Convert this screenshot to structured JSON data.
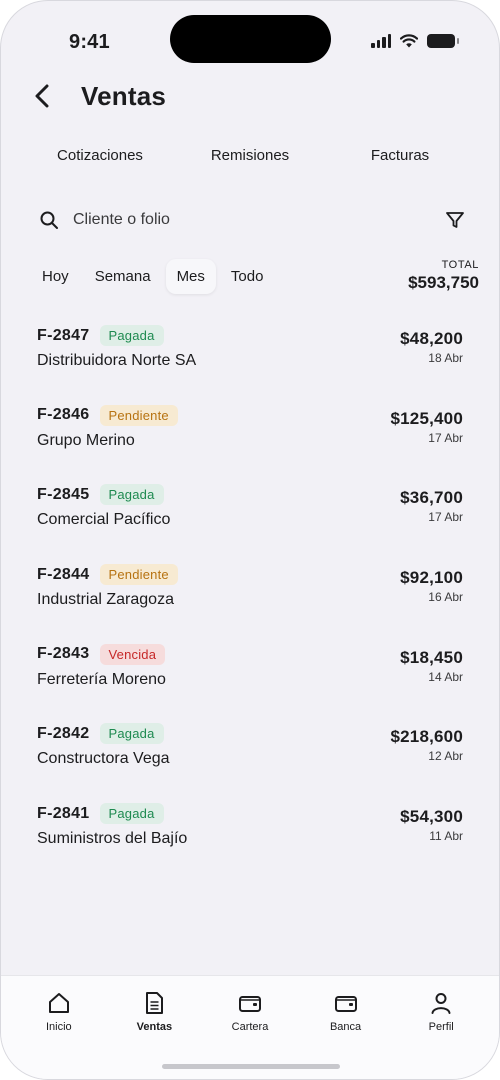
{
  "status": {
    "time": "9:41"
  },
  "header": {
    "title": "Ventas"
  },
  "segments": [
    "Cotizaciones",
    "Remisiones",
    "Facturas"
  ],
  "search": {
    "placeholder": "Cliente o folio"
  },
  "periods": [
    "Hoy",
    "Semana",
    "Mes",
    "Todo"
  ],
  "active_period": "Mes",
  "total": {
    "label": "TOTAL",
    "value": "$593,750"
  },
  "invoices": [
    {
      "folio": "F-2847",
      "status": "Pagada",
      "status_key": "pagada",
      "client": "Distribuidora Norte SA",
      "amount": "$48,200",
      "date": "18 Abr"
    },
    {
      "folio": "F-2846",
      "status": "Pendiente",
      "status_key": "pendiente",
      "client": "Grupo Merino",
      "amount": "$125,400",
      "date": "17 Abr"
    },
    {
      "folio": "F-2845",
      "status": "Pagada",
      "status_key": "pagada",
      "client": "Comercial Pacífico",
      "amount": "$36,700",
      "date": "17 Abr"
    },
    {
      "folio": "F-2844",
      "status": "Pendiente",
      "status_key": "pendiente",
      "client": "Industrial Zaragoza",
      "amount": "$92,100",
      "date": "16 Abr"
    },
    {
      "folio": "F-2843",
      "status": "Vencida",
      "status_key": "vencida",
      "client": "Ferretería Moreno",
      "amount": "$18,450",
      "date": "14 Abr"
    },
    {
      "folio": "F-2842",
      "status": "Pagada",
      "status_key": "pagada",
      "client": "Constructora Vega",
      "amount": "$218,600",
      "date": "12 Abr"
    },
    {
      "folio": "F-2841",
      "status": "Pagada",
      "status_key": "pagada",
      "client": "Suministros del Bajío",
      "amount": "$54,300",
      "date": "11 Abr"
    }
  ],
  "tabbar": {
    "items": [
      {
        "label": "Inicio",
        "icon": "home-icon"
      },
      {
        "label": "Ventas",
        "icon": "document-icon"
      },
      {
        "label": "Cartera",
        "icon": "wallet-icon"
      },
      {
        "label": "Banca",
        "icon": "wallet-icon"
      },
      {
        "label": "Perfil",
        "icon": "person-icon"
      }
    ],
    "active": "Ventas"
  },
  "colors": {
    "background": "#f2f1f6",
    "pagada_text": "#1e8a50",
    "pendiente_text": "#b77312",
    "vencida_text": "#c62828"
  }
}
